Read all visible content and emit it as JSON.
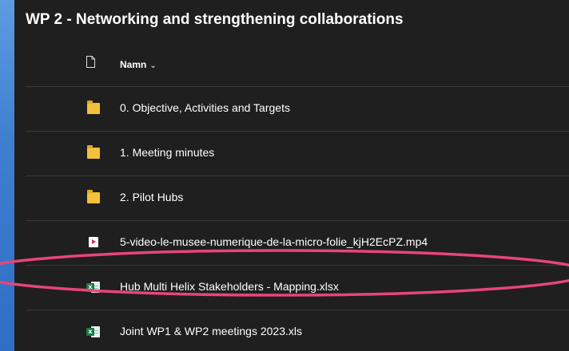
{
  "title": "WP 2 - Networking and strengthening collaborations",
  "columns": {
    "name_label": "Namn",
    "sort_icon": "chevron-down-icon",
    "type_icon": "document-icon"
  },
  "items": [
    {
      "name": "0. Objective, Activities and Targets",
      "type": "folder"
    },
    {
      "name": "1. Meeting minutes",
      "type": "folder"
    },
    {
      "name": "2. Pilot Hubs",
      "type": "folder"
    },
    {
      "name": "5-video-le-musee-numerique-de-la-micro-folie_kjH2EcPZ.mp4",
      "type": "video"
    },
    {
      "name": "Hub Multi Helix Stakeholders - Mapping.xlsx",
      "type": "excel"
    },
    {
      "name": "Joint WP1 & WP2 meetings 2023.xls",
      "type": "excel"
    }
  ],
  "highlight": {
    "target_item": "Hub Multi Helix Stakeholders - Mapping.xlsx",
    "color": "#e8457a"
  },
  "colors": {
    "panel_bg": "#1f1f1f",
    "folder": "#f3c13a",
    "excel": "#1d7a45",
    "video_accent": "#d6285a",
    "background": "#3f7fcf"
  }
}
